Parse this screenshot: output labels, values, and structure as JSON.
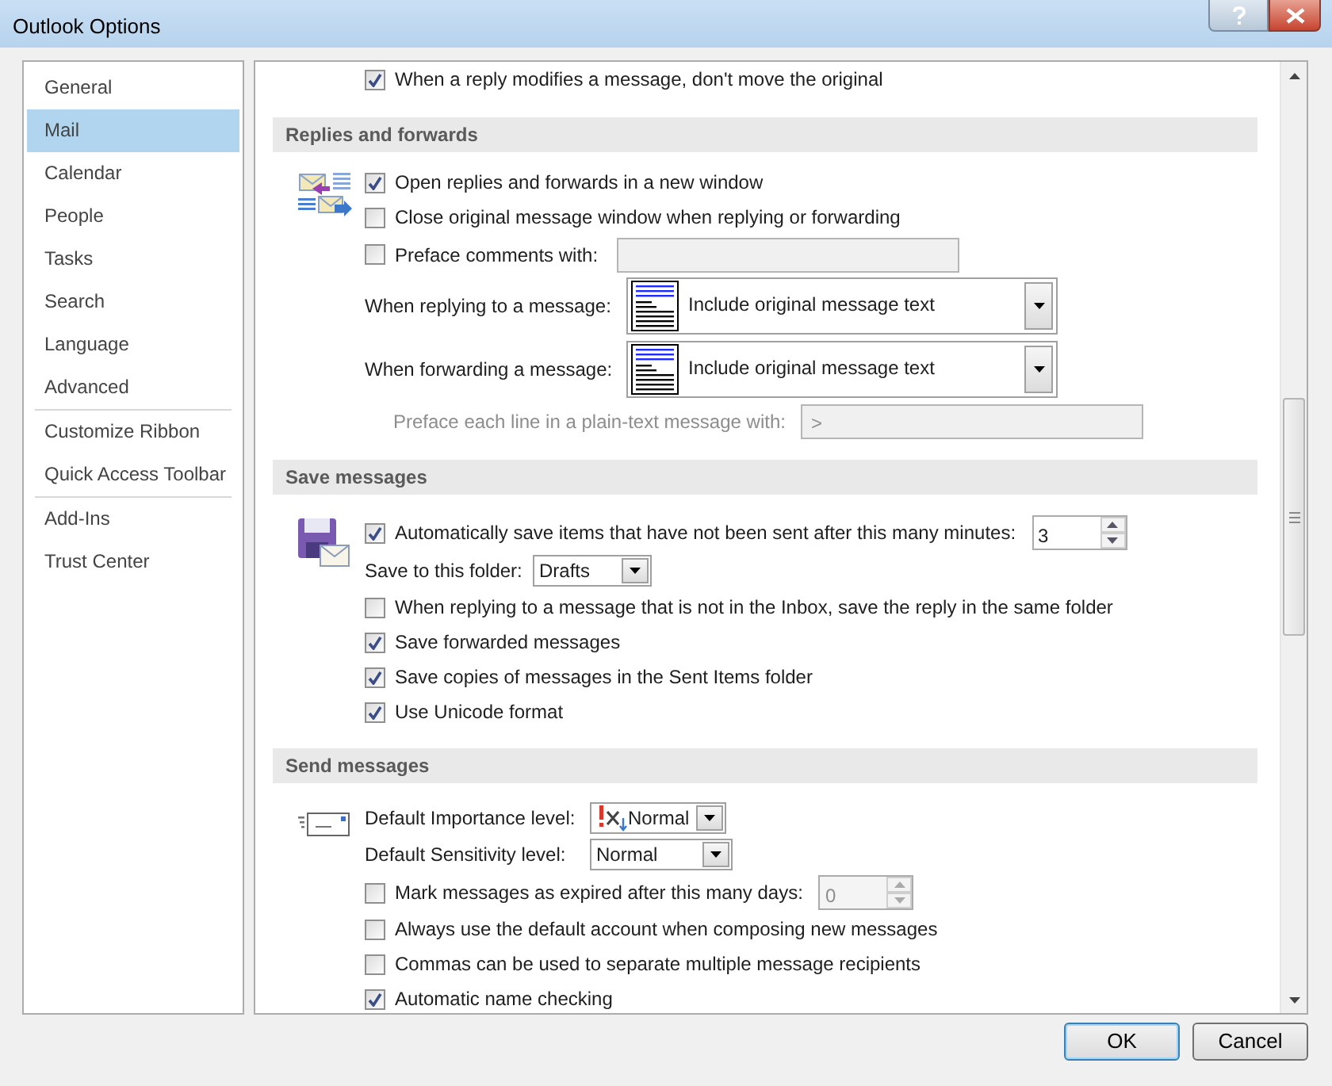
{
  "window": {
    "title": "Outlook Options"
  },
  "sidebar": {
    "groups": [
      [
        {
          "label": "General",
          "selected": false
        },
        {
          "label": "Mail",
          "selected": true
        },
        {
          "label": "Calendar",
          "selected": false
        },
        {
          "label": "People",
          "selected": false
        },
        {
          "label": "Tasks",
          "selected": false
        },
        {
          "label": "Search",
          "selected": false
        },
        {
          "label": "Language",
          "selected": false
        },
        {
          "label": "Advanced",
          "selected": false
        }
      ],
      [
        {
          "label": "Customize Ribbon",
          "selected": false
        },
        {
          "label": "Quick Access Toolbar",
          "selected": false
        }
      ],
      [
        {
          "label": "Add-Ins",
          "selected": false
        },
        {
          "label": "Trust Center",
          "selected": false
        }
      ]
    ]
  },
  "top_rows": [
    {
      "kind": "checkbox",
      "label": "When a reply modifies a message, don't move the original",
      "checked": true
    }
  ],
  "sections": [
    {
      "title": "Replies and forwards",
      "rows": [
        {
          "kind": "checkbox",
          "label": "Open replies and forwards in a new window",
          "checked": true
        },
        {
          "kind": "checkbox",
          "label": "Close original message window when replying or forwarding",
          "checked": false
        },
        {
          "kind": "checkbox",
          "label": "Preface comments with:",
          "checked": false,
          "field": {
            "disabled": true
          }
        },
        {
          "kind": "template-select",
          "label": "When replying to a message:",
          "value": "Include original message text"
        },
        {
          "kind": "template-select",
          "label": "When forwarding a message:",
          "value": "Include original message text"
        },
        {
          "kind": "text-field",
          "label": "Preface each line in a plain-text message with:",
          "value": ">",
          "disabled": true
        }
      ]
    },
    {
      "title": "Save messages",
      "rows": [
        {
          "kind": "checkbox",
          "label": "Automatically save items that have not been sent after this many minutes:",
          "checked": true,
          "spin": {
            "value": "3",
            "disabled": false
          }
        },
        {
          "kind": "select",
          "label": "Save to this folder:",
          "value": "Drafts"
        },
        {
          "kind": "checkbox",
          "label": "When replying to a message that is not in the Inbox, save the reply in the same folder",
          "checked": false
        },
        {
          "kind": "checkbox",
          "label": "Save forwarded messages",
          "checked": true
        },
        {
          "kind": "checkbox",
          "label": "Save copies of messages in the Sent Items folder",
          "checked": true
        },
        {
          "kind": "checkbox",
          "label": "Use Unicode format",
          "checked": true
        }
      ]
    },
    {
      "title": "Send messages",
      "rows": [
        {
          "kind": "importance-select",
          "label": "Default Importance level:",
          "value": "Normal"
        },
        {
          "kind": "select",
          "label": "Default Sensitivity level:",
          "value": "Normal"
        },
        {
          "kind": "checkbox",
          "label": "Mark messages as expired after this many days:",
          "checked": false,
          "spin": {
            "value": "0",
            "disabled": true
          }
        },
        {
          "kind": "checkbox",
          "label": "Always use the default account when composing new messages",
          "checked": false
        },
        {
          "kind": "checkbox",
          "label": "Commas can be used to separate multiple message recipients",
          "checked": false
        },
        {
          "kind": "checkbox",
          "label": "Automatic name checking",
          "checked": true
        }
      ]
    }
  ],
  "buttons": [
    {
      "label": "OK",
      "default": true
    },
    {
      "label": "Cancel",
      "default": false
    }
  ]
}
